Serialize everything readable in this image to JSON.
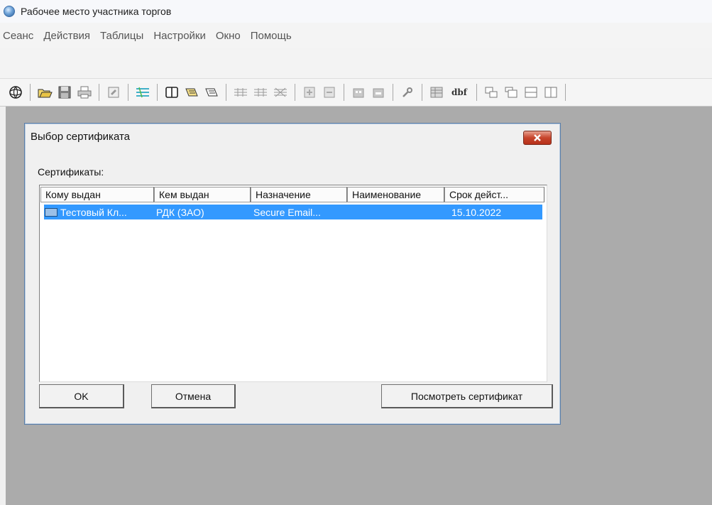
{
  "window": {
    "title": "Рабочее место участника торгов"
  },
  "menu": [
    "Сеанс",
    "Действия",
    "Таблицы",
    "Настройки",
    "Окно",
    "Помощь"
  ],
  "toolbar": {
    "dbf_label": "dbf"
  },
  "dialog": {
    "title": "Выбор сертификата",
    "list_label": "Сертификаты:",
    "columns": [
      "Кому выдан",
      "Кем выдан",
      "Назначение",
      "Наименование",
      "Срок дейст..."
    ],
    "rows": [
      {
        "issued_to": "Тестовый Кл...",
        "issued_by": "РДК (ЗАО)",
        "purpose": "Secure Email...",
        "name": "",
        "expires": "15.10.2022"
      }
    ],
    "buttons": {
      "ok": "OK",
      "cancel": "Отмена",
      "view": "Посмотреть сертификат"
    }
  },
  "colors": {
    "selection": "#3399ff",
    "workspace": "#ababab",
    "close_button": "#c7452c"
  }
}
